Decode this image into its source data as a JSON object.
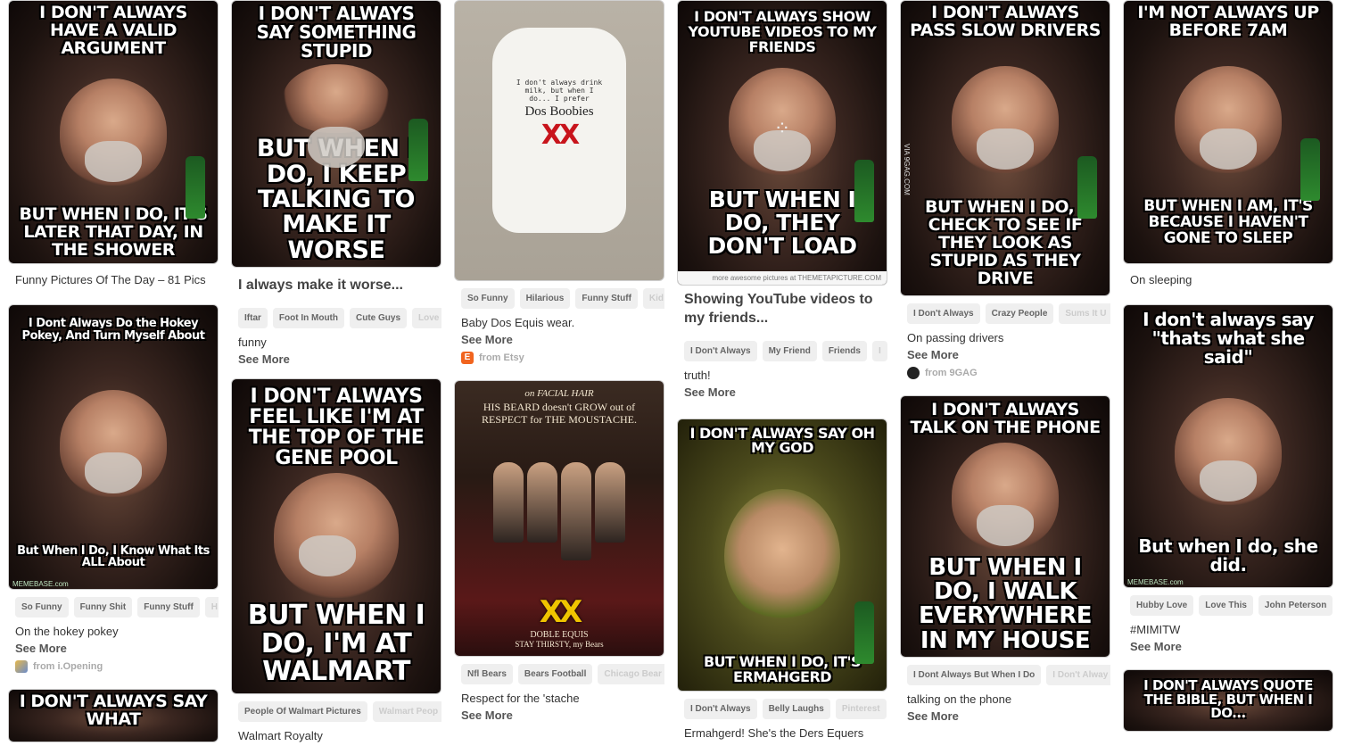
{
  "columns": [
    {
      "pins": [
        {
          "top": "I don't always have a valid argument",
          "bottom": "But when I do, it's later that day, in the shower",
          "caption": "Funny Pictures Of The Day – 81 Pics"
        },
        {
          "top": "I Dont Always Do the Hokey Pokey, And Turn Myself About",
          "bottom": "But When I Do, I Know What Its ALL About",
          "watermark": "MEMEBASE.com",
          "tags": [
            "So Funny",
            "Funny Shit",
            "Funny Stuff",
            "H"
          ],
          "desc": "On the hokey pokey",
          "see_more": "See More",
          "source": "from i.Opening"
        },
        {
          "top": "I don't always say what"
        }
      ]
    },
    {
      "pins": [
        {
          "top": "I don't always say something stupid",
          "bottom": "But when I do, I keep talking to make it worse",
          "caption": "I always make it worse...",
          "tags": [
            "Iftar",
            "Foot In Mouth",
            "Cute Guys",
            "Love"
          ],
          "desc": "funny",
          "see_more": "See More"
        },
        {
          "top": "I don't always feel like I'm at the top of the gene pool",
          "bottom": "But when I do, I'm at Walmart",
          "tags": [
            "People Of Walmart Pictures",
            "Walmart Peop"
          ],
          "desc": "Walmart Royalty"
        }
      ]
    },
    {
      "pins": [
        {
          "onesie_small": "I don't always drink milk, but when I do... I prefer",
          "onesie_brand": "Dos Boobies",
          "onesie_xx": "XX",
          "tags": [
            "So Funny",
            "Hilarious",
            "Funny Stuff",
            "Kid"
          ],
          "desc": "Baby Dos Equis wear.",
          "see_more": "See More",
          "source": "from Etsy"
        },
        {
          "ad_top": "on FACIAL HAIR",
          "ad_head": "HIS BEARD doesn't GROW out of RESPECT for THE MOUSTACHE.",
          "ad_logo": "XX",
          "ad_brand": "DOBLE EQUIS",
          "ad_sub": "STAY THIRSTY, my Bears",
          "tags": [
            "Nfl Bears",
            "Bears Football",
            "Chicago Bear"
          ],
          "desc": "Respect for the 'stache",
          "see_more": "See More"
        }
      ]
    },
    {
      "pins": [
        {
          "top": "I don't always show YouTube videos to my friends",
          "bottom": "But when I do, they don't load",
          "credit": "more awesome pictures at THEMETAPICTURE.COM",
          "caption": "Showing YouTube videos to my friends...",
          "tags": [
            "I Don't Always",
            "My Friend",
            "Friends",
            "I"
          ],
          "desc": "truth!",
          "see_more": "See More"
        },
        {
          "top": "I don't always say oh my god",
          "bottom": "But when I do, it's ermahgerd",
          "tags": [
            "I Don't Always",
            "Belly Laughs",
            "Pinterest"
          ],
          "desc": "Ermahgerd! She's the Ders Equers"
        }
      ]
    },
    {
      "pins": [
        {
          "top": "I don't always pass slow drivers",
          "bottom": "But when I do, I check to see if they look as stupid as they drive",
          "watermark": "VIA 9GAG.COM",
          "tags": [
            "I Don't Always",
            "Crazy People",
            "Sums It U"
          ],
          "desc": "On passing drivers",
          "see_more": "See More",
          "source": "from 9GAG"
        },
        {
          "top": "I don't always talk on the phone",
          "bottom": "But when I do, I walk everywhere in my house",
          "tags": [
            "I Dont Always But When I Do",
            "I Don't Alway"
          ],
          "desc": "talking on the phone",
          "see_more": "See More"
        }
      ]
    },
    {
      "pins": [
        {
          "top": "I'm not always up before 7am",
          "bottom": "But when I am, it's because I haven't gone to sleep",
          "caption": "On sleeping"
        },
        {
          "top": "I don't always say \"thats what she said\"",
          "bottom": "But when I do, she did.",
          "watermark": "MEMEBASE.com",
          "tags": [
            "Hubby Love",
            "Love This",
            "John Peterson"
          ],
          "desc": "#MIMITW",
          "see_more": "See More"
        },
        {
          "top": "I don't always quote the bible, but when I do..."
        }
      ]
    }
  ],
  "colors": {
    "etsy": "#f1641e",
    "ninegag": "#222222",
    "tag_bg": "#efefef",
    "memebase_green": "#2e7d32"
  },
  "icons": [
    "chevron-right-icon",
    "etsy-icon",
    "ninegag-icon",
    "play-dots-icon",
    "beer-bottle-icon"
  ]
}
